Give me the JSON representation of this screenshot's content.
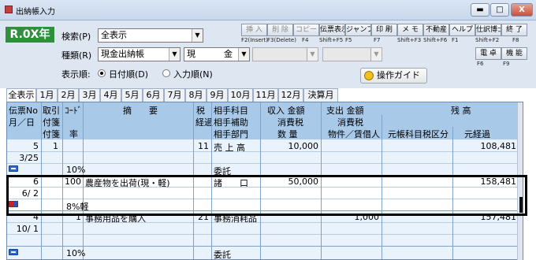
{
  "window": {
    "title": "出納帳入力",
    "min": "▬",
    "max": "□",
    "close": "X"
  },
  "logo": "R.0X年",
  "search": {
    "label": "検索(P)",
    "value": "全表示"
  },
  "kind": {
    "label": "種類(R)",
    "value": "現金出納帳",
    "account": "現",
    "account2": "金"
  },
  "order": {
    "label": "表示順:",
    "option1": "日付順(D)",
    "option2": "入力順(N)"
  },
  "fbuttons": [
    {
      "label": "挿 入",
      "key": "F2(Insert)"
    },
    {
      "label": "削 除",
      "key": "F3(Delete)"
    },
    {
      "label": "コピー",
      "key": "F4"
    },
    {
      "label": "伝票表示",
      "key": "Shift+F5"
    },
    {
      "label": "ジャンプ",
      "key": "F5"
    },
    {
      "label": "印 刷",
      "key": "F7"
    },
    {
      "label": "メ モ",
      "key": "Shift+F3"
    },
    {
      "label": "不動産",
      "key": "Shift+F6"
    },
    {
      "label": "ヘルプ",
      "key": "F1"
    },
    {
      "label": "仕訳博士",
      "key": "Shift+F2"
    },
    {
      "label": "終 了",
      "key": "F8"
    }
  ],
  "fbuttons2": [
    {
      "label": "電 卓",
      "key": "F6"
    },
    {
      "label": "機 能",
      "key": "F9"
    }
  ],
  "guide": "操作ガイド",
  "tabs": [
    "全表示",
    "1月",
    "2月",
    "3月",
    "4月",
    "5月",
    "6月",
    "7月",
    "8月",
    "9月",
    "10月",
    "11月",
    "12月",
    "決算月"
  ],
  "header": {
    "h1": [
      "伝票No",
      "取引",
      "ｺｰﾄﾞ",
      "摘　　要",
      "税",
      "相手科目",
      "収入 金額",
      "支出 金額",
      "残 高"
    ],
    "h2": [
      "月／日",
      "付箋",
      "税区分",
      "経過",
      "相手補助",
      "消費税",
      "消費税"
    ],
    "h3": [
      "付箋",
      "率",
      "相手部門",
      "数 量",
      "物件／賃借人",
      "元帳科目税区分",
      "元経過"
    ]
  },
  "rows": [
    {
      "no": "5",
      "trade": "1",
      "code": "",
      "desc": "",
      "tax": "11",
      "acct": "売 上 高",
      "income": "10,000",
      "expense": "",
      "balance": "108,481",
      "date": "3/25",
      "rate": "10%",
      "sub": "委託"
    },
    {
      "no": "6",
      "trade": "",
      "code": "100",
      "desc": "農産物を出荷(現・軽)",
      "tax": "",
      "acct": "諸　　口",
      "income": "50,000",
      "expense": "",
      "balance": "158,481",
      "date": "6/ 2",
      "rate": "8%軽",
      "sub": ""
    },
    {
      "no": "4",
      "trade": "",
      "code": "1",
      "desc": "事務用品を購入",
      "tax": "21",
      "acct": "事務消耗品",
      "income": "",
      "expense": "1,000",
      "balance": "157,481",
      "date": "10/ 1",
      "rate": "10%",
      "sub": "委託"
    }
  ]
}
